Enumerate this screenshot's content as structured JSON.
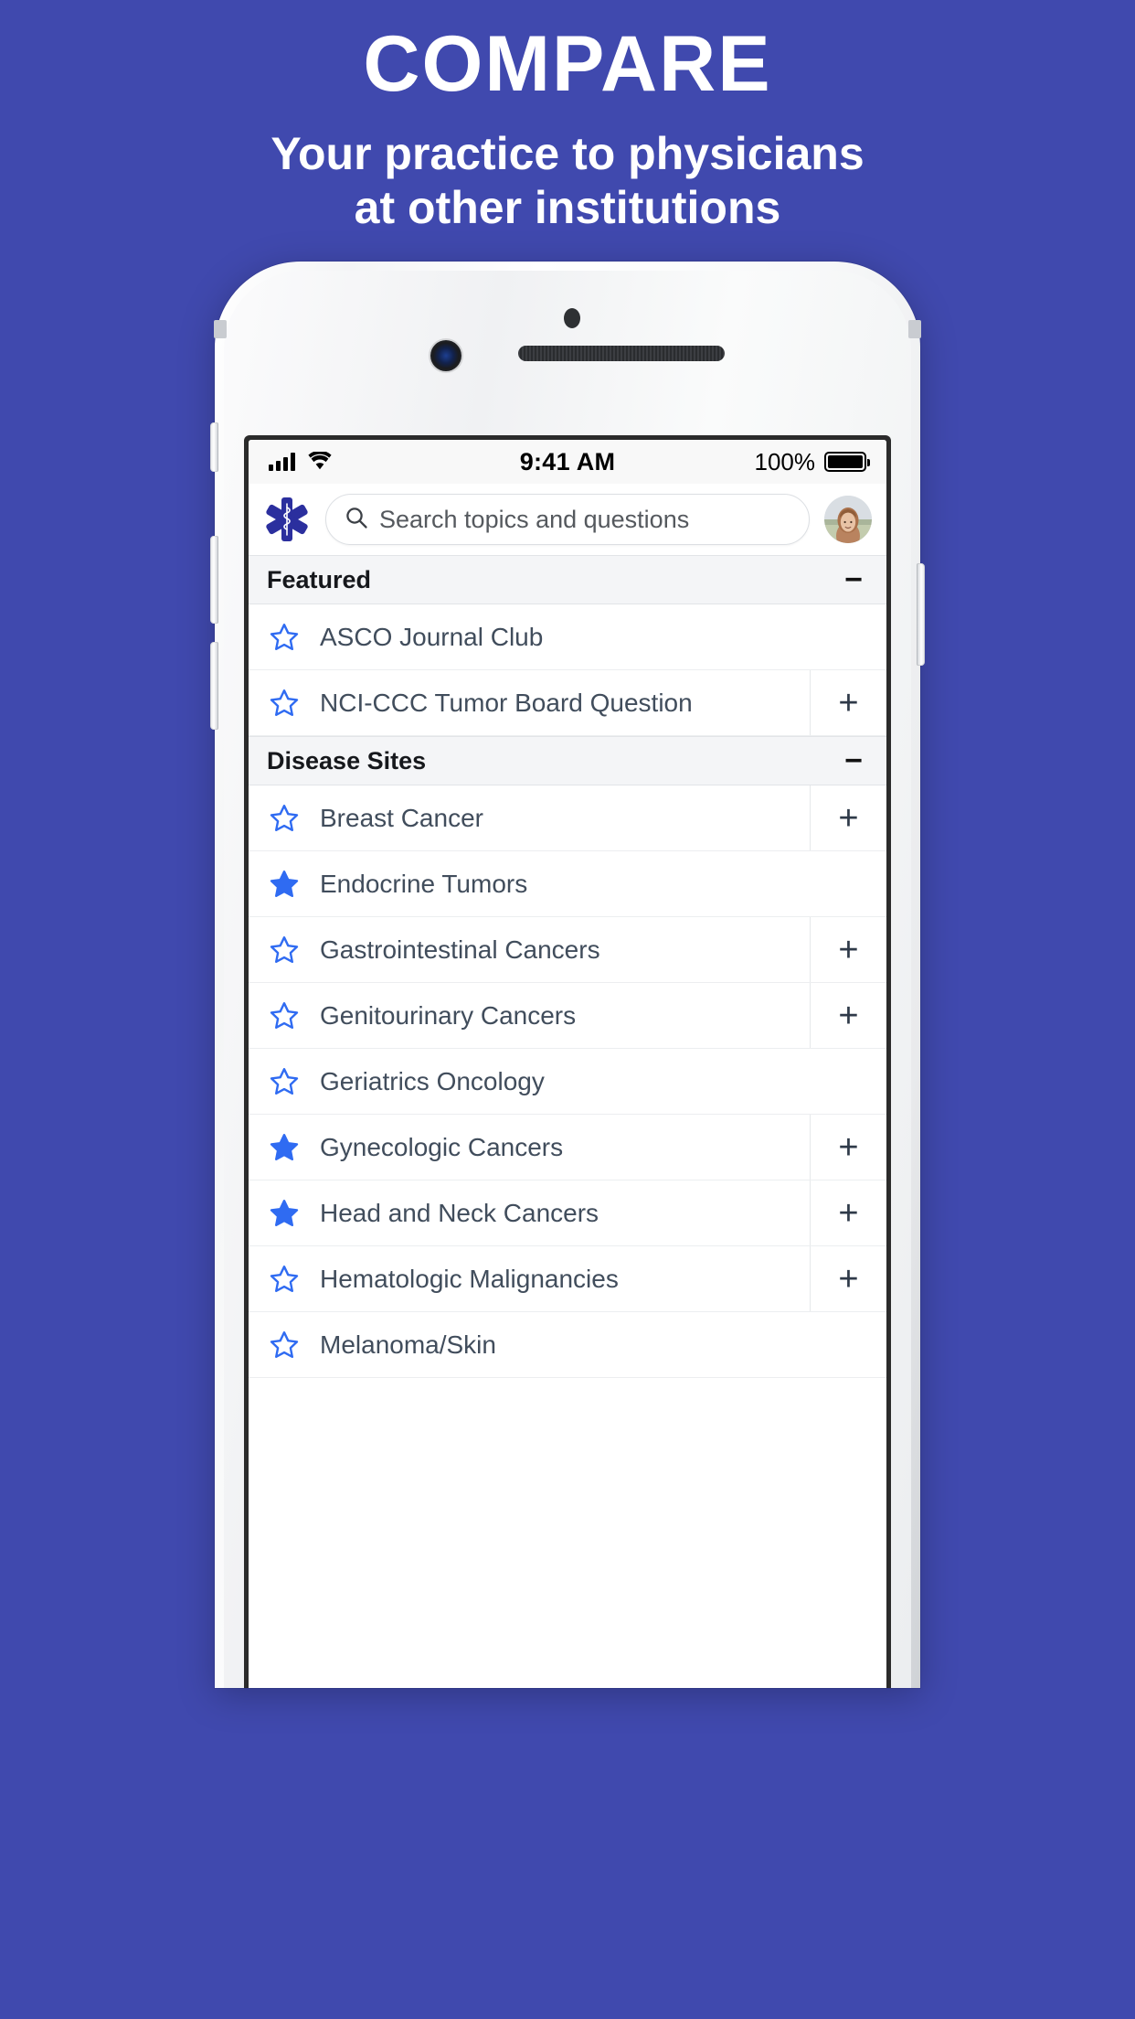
{
  "promo": {
    "title": "COMPARE",
    "subtitle_line1": "Your practice to physicians",
    "subtitle_line2": "at other institutions",
    "background_color": "#4049ae",
    "text_color": "#ffffff"
  },
  "statusbar": {
    "signal_icon": "cellular-signal-icon",
    "wifi_icon": "wifi-icon",
    "time": "9:41 AM",
    "battery_percent": "100%",
    "battery_icon": "battery-full-icon"
  },
  "header": {
    "logo_icon": "star-of-life-logo-icon",
    "search_icon": "search-icon",
    "search_value": "",
    "search_placeholder": "Search topics and questions",
    "avatar_icon": "user-avatar"
  },
  "accent": {
    "star_blue": "#2f6bf2",
    "logo_blue": "#2b2f9e"
  },
  "sections": [
    {
      "title": "Featured",
      "collapse_label": "−",
      "rows": [
        {
          "label": "ASCO Journal Club",
          "starred": false,
          "add_label": ""
        },
        {
          "label": "NCI-CCC Tumor Board Question",
          "starred": false,
          "add_label": "+"
        }
      ]
    },
    {
      "title": "Disease Sites",
      "collapse_label": "−",
      "rows": [
        {
          "label": "Breast Cancer",
          "starred": false,
          "add_label": "+"
        },
        {
          "label": "Endocrine Tumors",
          "starred": true,
          "add_label": ""
        },
        {
          "label": "Gastrointestinal Cancers",
          "starred": false,
          "add_label": "+"
        },
        {
          "label": "Genitourinary Cancers",
          "starred": false,
          "add_label": "+"
        },
        {
          "label": "Geriatrics Oncology",
          "starred": false,
          "add_label": ""
        },
        {
          "label": "Gynecologic Cancers",
          "starred": true,
          "add_label": "+"
        },
        {
          "label": "Head and Neck Cancers",
          "starred": true,
          "add_label": "+"
        },
        {
          "label": "Hematologic Malignancies",
          "starred": false,
          "add_label": "+"
        },
        {
          "label": "Melanoma/Skin",
          "starred": false,
          "add_label": ""
        }
      ]
    }
  ]
}
